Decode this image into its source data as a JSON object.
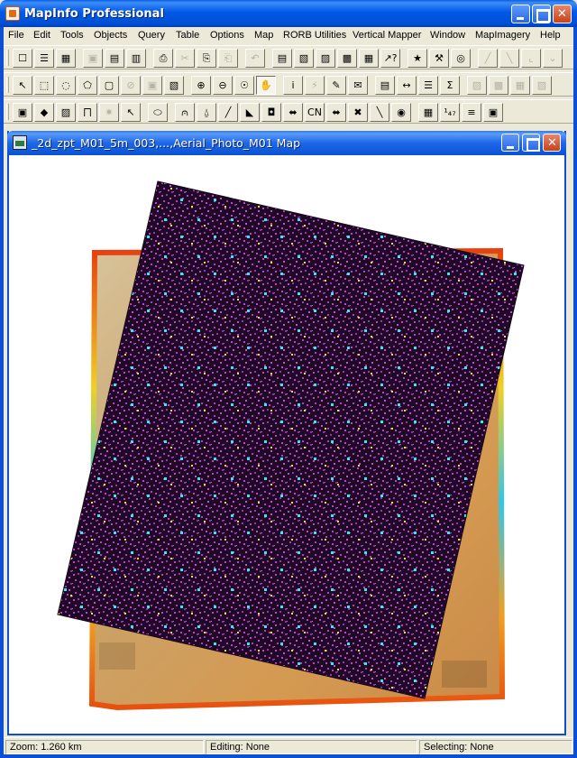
{
  "app": {
    "title": "MapInfo Professional"
  },
  "menu": [
    "File",
    "Edit",
    "Tools",
    "Objects",
    "Query",
    "Table",
    "Options",
    "Map",
    "RORB Utilities",
    "Vertical Mapper",
    "Window",
    "MapImagery",
    "Help"
  ],
  "toolbars": {
    "row1": [
      {
        "name": "new-table-button",
        "glyph": "☐",
        "enabled": true
      },
      {
        "name": "open-table-button",
        "glyph": "☰",
        "enabled": true
      },
      {
        "name": "open-workspace-button",
        "glyph": "▦",
        "enabled": true
      },
      {
        "name": "save-button",
        "glyph": "▣",
        "enabled": false
      },
      {
        "name": "save-workspace-button",
        "glyph": "▤",
        "enabled": true
      },
      {
        "name": "print-preview-button",
        "glyph": "▥",
        "enabled": true
      },
      {
        "name": "print-button",
        "glyph": "⎙",
        "enabled": true
      },
      {
        "name": "cut-button",
        "glyph": "✂",
        "enabled": false
      },
      {
        "name": "copy-button",
        "glyph": "⎘",
        "enabled": true
      },
      {
        "name": "paste-button",
        "glyph": "⎗",
        "enabled": false
      },
      {
        "name": "undo-button",
        "glyph": "↶",
        "enabled": false
      },
      {
        "name": "new-browser-button",
        "glyph": "▤",
        "enabled": true
      },
      {
        "name": "new-mapper-button",
        "glyph": "▧",
        "enabled": true
      },
      {
        "name": "new-grapher-button",
        "glyph": "▨",
        "enabled": true
      },
      {
        "name": "new-layout-button",
        "glyph": "▩",
        "enabled": true
      },
      {
        "name": "new-redistrict-button",
        "glyph": "▦",
        "enabled": true
      },
      {
        "name": "help-pointer-button",
        "glyph": "↗?",
        "enabled": true
      },
      {
        "name": "run-tool-button",
        "glyph": "★",
        "enabled": true
      },
      {
        "name": "tool-manager-button",
        "glyph": "⚒",
        "enabled": true
      },
      {
        "name": "globe-button",
        "glyph": "◎",
        "enabled": true
      },
      {
        "name": "disabled-tool-1-button",
        "glyph": "╱",
        "enabled": false
      },
      {
        "name": "disabled-tool-2-button",
        "glyph": "╲",
        "enabled": false
      },
      {
        "name": "disabled-tool-3-button",
        "glyph": "⌞",
        "enabled": false
      },
      {
        "name": "disabled-tool-4-button",
        "glyph": "⌄",
        "enabled": false
      }
    ],
    "row2": [
      {
        "name": "select-arrow-button",
        "glyph": "↖",
        "enabled": true
      },
      {
        "name": "marquee-select-button",
        "glyph": "⬚",
        "enabled": true
      },
      {
        "name": "radius-select-button",
        "glyph": "◌",
        "enabled": true
      },
      {
        "name": "polygon-select-button",
        "glyph": "⬠",
        "enabled": true
      },
      {
        "name": "boundary-select-button",
        "glyph": "▢",
        "enabled": true
      },
      {
        "name": "unselect-all-button",
        "glyph": "⊘",
        "enabled": false
      },
      {
        "name": "invert-selection-button",
        "glyph": "▣",
        "enabled": false
      },
      {
        "name": "graph-select-button",
        "glyph": "▧",
        "enabled": true
      },
      {
        "name": "zoom-in-button",
        "glyph": "⊕",
        "enabled": true
      },
      {
        "name": "zoom-out-button",
        "glyph": "⊖",
        "enabled": true
      },
      {
        "name": "change-view-button",
        "glyph": "☉",
        "enabled": true
      },
      {
        "name": "grabber-hand-button",
        "glyph": "✋",
        "enabled": true,
        "pressed": true
      },
      {
        "name": "info-tool-button",
        "glyph": "i",
        "enabled": true
      },
      {
        "name": "hotlink-button",
        "glyph": "⚡",
        "enabled": false
      },
      {
        "name": "label-tool-button",
        "glyph": "✎",
        "enabled": true
      },
      {
        "name": "drag-window-button",
        "glyph": "✉",
        "enabled": true
      },
      {
        "name": "layer-control-button",
        "glyph": "▤",
        "enabled": true
      },
      {
        "name": "ruler-button",
        "glyph": "↔",
        "enabled": true
      },
      {
        "name": "legend-button",
        "glyph": "☰",
        "enabled": true
      },
      {
        "name": "statistics-button",
        "glyph": "Σ",
        "enabled": true
      },
      {
        "name": "disabled-tool-5-button",
        "glyph": "▨",
        "enabled": false
      },
      {
        "name": "disabled-tool-6-button",
        "glyph": "▩",
        "enabled": false
      },
      {
        "name": "disabled-tool-7-button",
        "glyph": "▦",
        "enabled": false
      },
      {
        "name": "disabled-tool-8-button",
        "glyph": "▧",
        "enabled": false
      }
    ],
    "row3": [
      {
        "name": "vm-tool-1-button",
        "glyph": "▣",
        "enabled": true
      },
      {
        "name": "vm-tool-2-button",
        "glyph": "◆",
        "enabled": true
      },
      {
        "name": "vm-tool-3-button",
        "glyph": "▨",
        "enabled": true
      },
      {
        "name": "vm-tool-4-button",
        "glyph": "⨅",
        "enabled": true
      },
      {
        "name": "vm-tool-5-button",
        "glyph": "✷",
        "enabled": false
      },
      {
        "name": "vm-tool-6-button",
        "glyph": "↖",
        "enabled": true
      },
      {
        "name": "vm-tool-7-button",
        "glyph": "⬭",
        "enabled": true
      },
      {
        "name": "vm-tool-8-button",
        "glyph": "⩀",
        "enabled": true
      },
      {
        "name": "vm-tool-9-button",
        "glyph": "⍙",
        "enabled": true
      },
      {
        "name": "vm-tool-10-button",
        "glyph": "╱",
        "enabled": true
      },
      {
        "name": "vm-tool-11-button",
        "glyph": "◣",
        "enabled": true
      },
      {
        "name": "vm-tool-12-button",
        "glyph": "◘",
        "enabled": true
      },
      {
        "name": "vm-tool-13-button",
        "glyph": "⬌",
        "enabled": true
      },
      {
        "name": "vm-tool-14-button",
        "glyph": "CN",
        "enabled": true
      },
      {
        "name": "vm-tool-15-button",
        "glyph": "⬌",
        "enabled": true
      },
      {
        "name": "vm-tool-16-button",
        "glyph": "✖",
        "enabled": true
      },
      {
        "name": "vm-tool-17-button",
        "glyph": "╲",
        "enabled": true
      },
      {
        "name": "vm-tool-18-button",
        "glyph": "◉",
        "enabled": true
      },
      {
        "name": "vm-tool-19-button",
        "glyph": "▦",
        "enabled": true
      },
      {
        "name": "vm-tool-20-button",
        "glyph": "¹₄₇",
        "enabled": true
      },
      {
        "name": "vm-tool-21-button",
        "glyph": "≡",
        "enabled": true
      },
      {
        "name": "vm-tool-22-button",
        "glyph": "▣",
        "enabled": true
      }
    ]
  },
  "map_window": {
    "title": "_2d_zpt_M01_5m_003,...,Aerial_Photo_M01 Map"
  },
  "status": {
    "zoom": "Zoom: 1.260 km",
    "editing": "Editing: None",
    "selecting": "Selecting: None"
  },
  "colors": {
    "xp_blue": "#0b4fd6",
    "grid_fill": "#2a0a2e",
    "point_magenta": "#c83cd0",
    "point_cyan": "#3ce8f0",
    "point_yellow": "#f0e040"
  }
}
